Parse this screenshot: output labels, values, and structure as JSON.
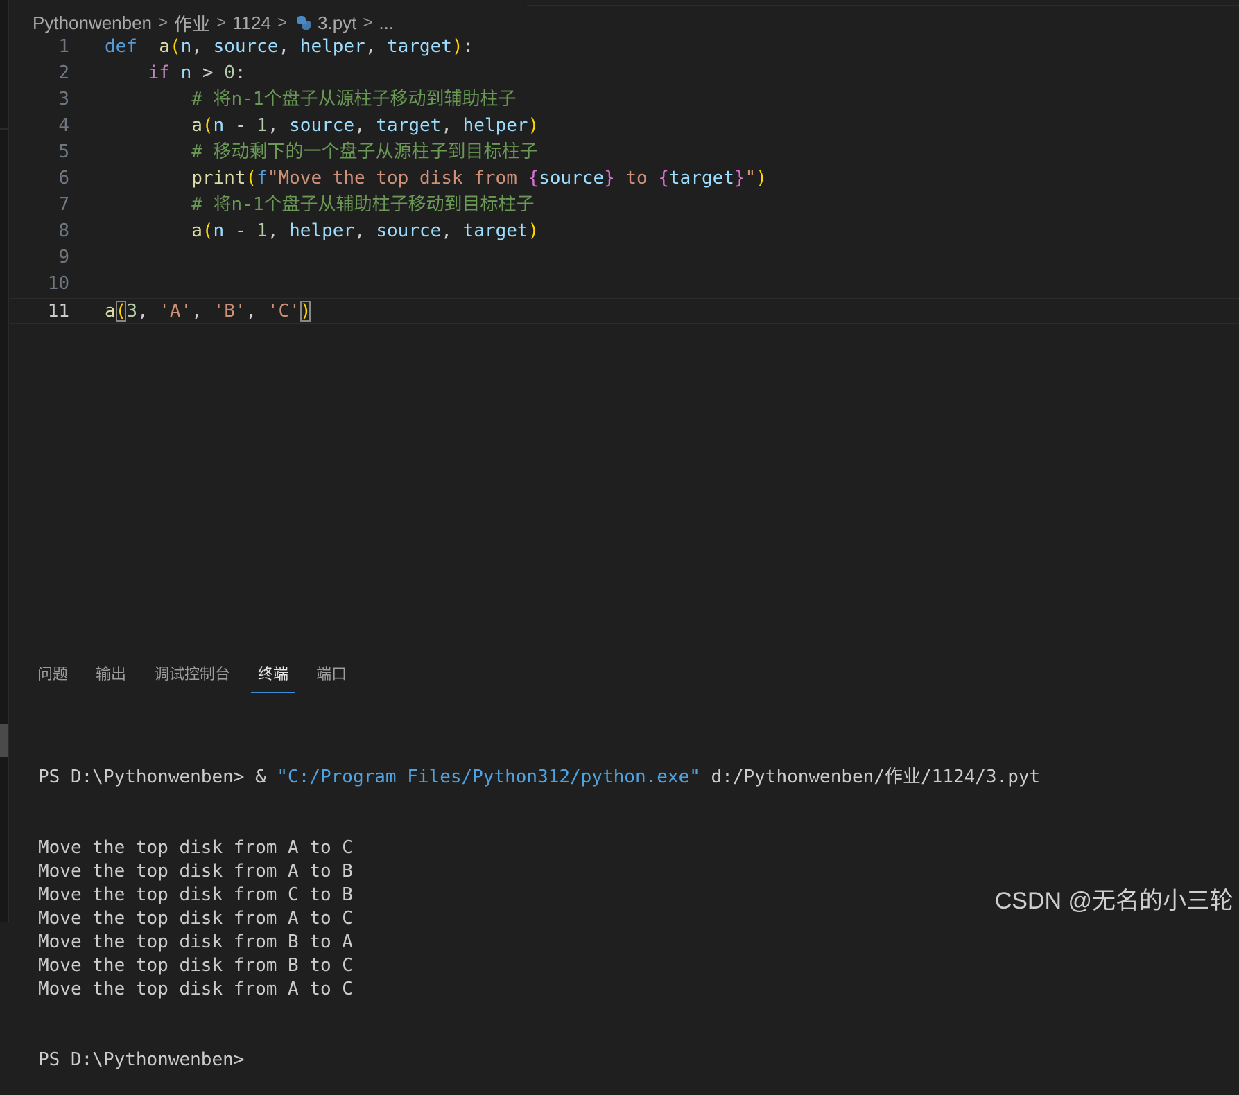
{
  "breadcrumb": {
    "items": [
      "Pythonwenben",
      "作业",
      "1124"
    ],
    "file": "3.pyt",
    "ellipsis": "...",
    "separator": ">",
    "file_icon": "python-icon"
  },
  "editor": {
    "line_numbers": [
      "1",
      "2",
      "3",
      "4",
      "5",
      "6",
      "7",
      "8",
      "9",
      "10",
      "11"
    ],
    "current_line": 11,
    "lines": [
      [
        [
          "kw",
          "def"
        ],
        [
          "",
          "  "
        ],
        [
          "fn",
          "a"
        ],
        [
          "p1",
          "("
        ],
        [
          "var",
          "n"
        ],
        [
          "",
          ", "
        ],
        [
          "var",
          "source"
        ],
        [
          "",
          ", "
        ],
        [
          "var",
          "helper"
        ],
        [
          "",
          ", "
        ],
        [
          "var",
          "target"
        ],
        [
          "p1",
          ")"
        ],
        [
          "",
          ":"
        ]
      ],
      [
        [
          "",
          "    "
        ],
        [
          "ctl",
          "if"
        ],
        [
          "",
          " "
        ],
        [
          "var",
          "n"
        ],
        [
          "",
          " > "
        ],
        [
          "num",
          "0"
        ],
        [
          "",
          ":"
        ]
      ],
      [
        [
          "",
          "        "
        ],
        [
          "cm",
          "# 将n-1个盘子从源柱子移动到辅助柱子"
        ]
      ],
      [
        [
          "",
          "        "
        ],
        [
          "fn",
          "a"
        ],
        [
          "p1",
          "("
        ],
        [
          "var",
          "n"
        ],
        [
          "",
          " - "
        ],
        [
          "num",
          "1"
        ],
        [
          "",
          ", "
        ],
        [
          "var",
          "source"
        ],
        [
          "",
          ", "
        ],
        [
          "var",
          "target"
        ],
        [
          "",
          ", "
        ],
        [
          "var",
          "helper"
        ],
        [
          "p1",
          ")"
        ]
      ],
      [
        [
          "",
          "        "
        ],
        [
          "cm",
          "# 移动剩下的一个盘子从源柱子到目标柱子"
        ]
      ],
      [
        [
          "",
          "        "
        ],
        [
          "fn",
          "print"
        ],
        [
          "p1",
          "("
        ],
        [
          "kw",
          "f"
        ],
        [
          "str",
          "\"Move the top disk from "
        ],
        [
          "p2",
          "{"
        ],
        [
          "var",
          "source"
        ],
        [
          "p2",
          "}"
        ],
        [
          "str",
          " to "
        ],
        [
          "p2",
          "{"
        ],
        [
          "var",
          "target"
        ],
        [
          "p2",
          "}"
        ],
        [
          "str",
          "\""
        ],
        [
          "p1",
          ")"
        ]
      ],
      [
        [
          "",
          "        "
        ],
        [
          "cm",
          "# 将n-1个盘子从辅助柱子移动到目标柱子"
        ]
      ],
      [
        [
          "",
          "        "
        ],
        [
          "fn",
          "a"
        ],
        [
          "p1",
          "("
        ],
        [
          "var",
          "n"
        ],
        [
          "",
          " - "
        ],
        [
          "num",
          "1"
        ],
        [
          "",
          ", "
        ],
        [
          "var",
          "helper"
        ],
        [
          "",
          ", "
        ],
        [
          "var",
          "source"
        ],
        [
          "",
          ", "
        ],
        [
          "var",
          "target"
        ],
        [
          "p1",
          ")"
        ]
      ],
      [],
      [],
      [
        [
          "fn",
          "a"
        ],
        [
          "p1 brk",
          "("
        ],
        [
          "num",
          "3"
        ],
        [
          "",
          ", "
        ],
        [
          "str",
          "'A'"
        ],
        [
          "",
          ", "
        ],
        [
          "str",
          "'B'"
        ],
        [
          "",
          ", "
        ],
        [
          "str",
          "'C'"
        ],
        [
          "p1 brk",
          ")"
        ]
      ]
    ]
  },
  "panel": {
    "tabs": [
      "问题",
      "输出",
      "调试控制台",
      "终端",
      "端口"
    ],
    "active_tab": "终端"
  },
  "terminal": {
    "command": {
      "prompt": "PS D:\\Pythonwenben> ",
      "op": "& ",
      "exe": "\"C:/Program Files/Python312/python.exe\"",
      "arg": " d:/Pythonwenben/作业/1124/3.pyt"
    },
    "output": [
      "Move the top disk from A to C",
      "Move the top disk from A to B",
      "Move the top disk from C to B",
      "Move the top disk from A to C",
      "Move the top disk from B to A",
      "Move the top disk from B to C",
      "Move the top disk from A to C"
    ],
    "final_prompt": "PS D:\\Pythonwenben>"
  },
  "watermark": "CSDN @无名的小三轮"
}
